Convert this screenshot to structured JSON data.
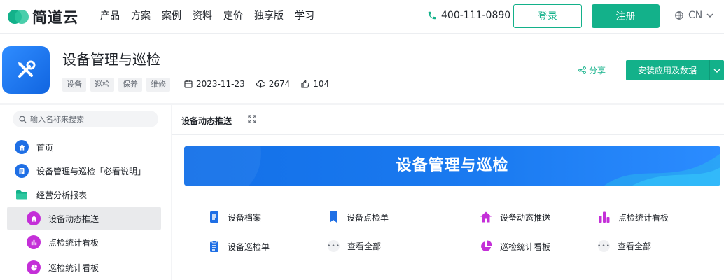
{
  "nav": {
    "logo_text": "简道云",
    "links": [
      "产品",
      "方案",
      "案例",
      "资料",
      "定价",
      "独享版",
      "学习"
    ],
    "phone": "400-111-0890",
    "login": "登录",
    "register": "注册",
    "lang": "CN"
  },
  "app": {
    "title": "设备管理与巡检",
    "tags": [
      "设备",
      "巡检",
      "保养",
      "维修"
    ],
    "date": "2023-11-23",
    "downloads": "2674",
    "likes": "104",
    "share": "分享",
    "install": "安装应用及数据"
  },
  "sidebar": {
    "search_placeholder": "输入名称来搜索",
    "items": [
      {
        "label": "首页"
      },
      {
        "label": "设备管理与巡检「必看说明」"
      },
      {
        "label": "经营分析报表"
      },
      {
        "label": "设备动态推送"
      },
      {
        "label": "点检统计看板"
      },
      {
        "label": "巡检统计看板"
      }
    ]
  },
  "content": {
    "tab": "设备动态推送",
    "banner_title": "设备管理与巡检",
    "tiles": [
      {
        "label": "设备档案"
      },
      {
        "label": "设备点检单"
      },
      {
        "label": "设备动态推送"
      },
      {
        "label": "点检统计看板"
      },
      {
        "label": "设备巡检单"
      },
      {
        "label": "查看全部"
      },
      {
        "label": "巡检统计看板"
      },
      {
        "label": "查看全部"
      }
    ]
  },
  "colors": {
    "brand_green": "#13b18a",
    "doc_blue": "#1f6fe5",
    "chart_purple": "#c42fd8"
  }
}
